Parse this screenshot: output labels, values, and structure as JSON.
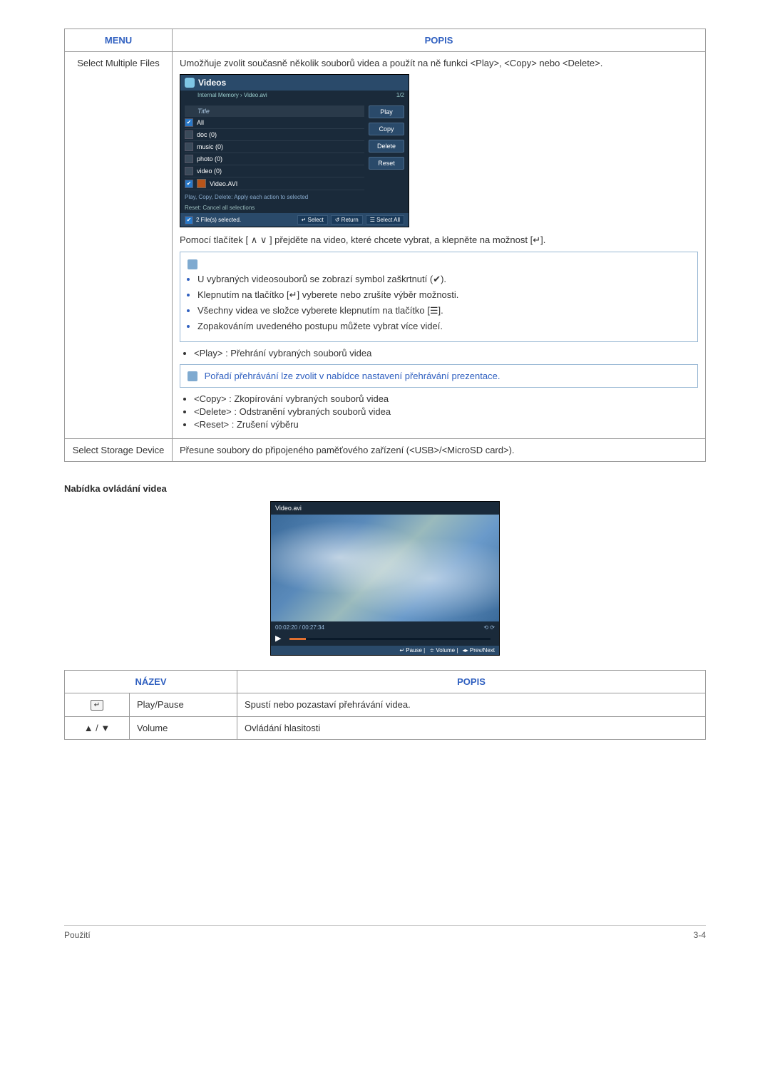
{
  "table1": {
    "header_menu": "MENU",
    "header_popis": "POPIS",
    "row1_menu": "Select Multiple Files",
    "row1_desc": "Umožňuje zvolit současně několik souborů videa a použít na ně funkci <Play>, <Copy> nebo <Delete>.",
    "screenshot": {
      "title": "Videos",
      "breadcrumb": "Internal Memory › Video.avi",
      "page": "1/2",
      "list": {
        "header": "Title",
        "items": [
          "All",
          "doc (0)",
          "music (0)",
          "photo (0)",
          "video (0)",
          "Video.AVI"
        ]
      },
      "buttons": [
        "Play",
        "Copy",
        "Delete",
        "Reset"
      ],
      "hint1": "Play, Copy, Delete: Apply each action to selected",
      "hint2": "Reset: Cancel all selections",
      "footer_left": "2 File(s) selected.",
      "footer_btns": [
        "Select",
        "Return",
        "Select All"
      ]
    },
    "after_screenshot": "Pomocí tlačítek [ ∧ ∨ ] přejděte na video, které chcete vybrat, a klepněte na možnost [↵].",
    "note1_items": [
      "U vybraných videosouborů se zobrazí symbol zaškrtnutí (✔).",
      "Klepnutím na tlačítko [↵] vyberete nebo zrušíte výběr možnosti.",
      "Všechny videa ve složce vyberete klepnutím na tlačítko [☰].",
      "Zopakováním uvedeného postupu můžete vybrat více videí."
    ],
    "play_line": "<Play> : Přehrání vybraných souborů videa",
    "note2": "Pořadí přehrávání lze zvolit v nabídce nastavení přehrávání prezentace.",
    "copy_line": "<Copy> : Zkopírování vybraných souborů videa",
    "delete_line": "<Delete> : Odstranění vybraných souborů videa",
    "reset_line": "<Reset> : Zrušení výběru",
    "row2_menu": "Select Storage Device",
    "row2_desc": "Přesune soubory do připojeného paměťového zařízení (<USB>/<MicroSD card>)."
  },
  "heading2": "Nabídka ovládání videa",
  "player": {
    "title": "Video.avi",
    "time": "00:02:20 / 00:27:34",
    "footer_pause": "↵ Pause",
    "footer_vol": "≑ Volume",
    "footer_nav": "◂▸ Prev/Next"
  },
  "table2": {
    "header_name": "NÁZEV",
    "header_popis": "POPIS",
    "r1_icon": "↵",
    "r1_name": "Play/Pause",
    "r1_desc": "Spustí nebo pozastaví přehrávání videa.",
    "r2_icon": "▲ / ▼",
    "r2_name": "Volume",
    "r2_desc": "Ovládání hlasitosti"
  },
  "footer": {
    "left": "Použití",
    "right": "3-4"
  }
}
